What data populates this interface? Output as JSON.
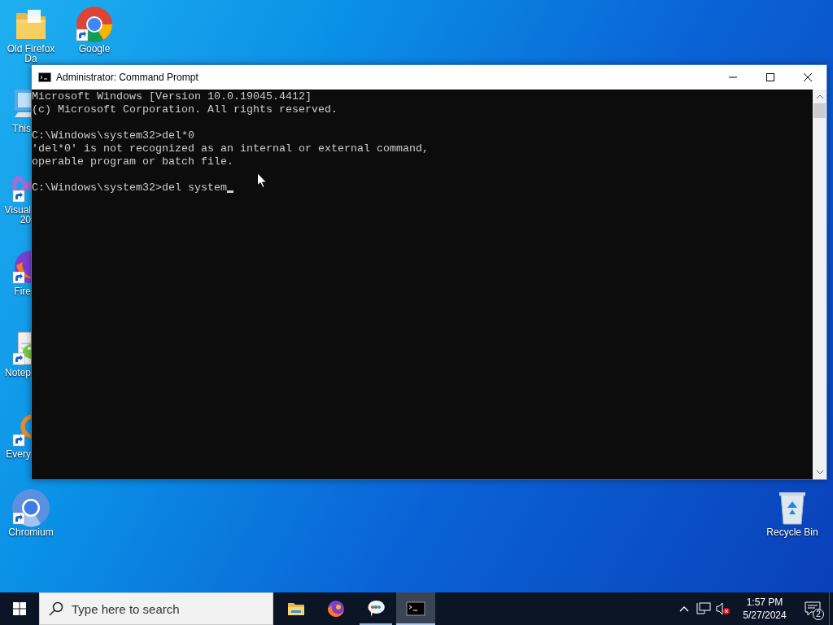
{
  "desktop_icons": [
    {
      "kind": "folder",
      "lines": [
        "Old Firefox",
        "Da"
      ],
      "shortcut": false
    },
    {
      "kind": "chrome",
      "lines": [
        "Google"
      ],
      "shortcut": true
    },
    {
      "kind": "computer",
      "lines": [
        "This"
      ],
      "shortcut": false
    },
    {
      "kind": "studio",
      "lines": [
        "Visual",
        "20"
      ],
      "shortcut": true
    },
    {
      "kind": "firefox",
      "lines": [
        "Fire"
      ],
      "shortcut": true
    },
    {
      "kind": "notepad",
      "lines": [
        "Notep"
      ],
      "shortcut": true
    },
    {
      "kind": "search",
      "lines": [
        "Every"
      ],
      "shortcut": true
    },
    {
      "kind": "chromium",
      "lines": [
        "Chromium"
      ],
      "shortcut": true
    },
    {
      "kind": "recycle",
      "lines": [
        "Recycle Bin"
      ],
      "shortcut": false
    }
  ],
  "window": {
    "title": "Administrator: Command Prompt",
    "console": {
      "blocks": [
        [
          "Microsoft Windows [Version 10.0.19045.4412]",
          "(c) Microsoft Corporation. All rights reserved."
        ],
        [
          "C:\\Windows\\system32>del*0",
          "'del*0' is not recognized as an internal or external command,",
          "operable program or batch file."
        ],
        [
          "C:\\Windows\\system32>del system"
        ]
      ],
      "cursor": true
    }
  },
  "taskbar": {
    "search": {
      "placeholder": "Type here to search"
    },
    "apps": [
      {
        "kind": "explorer",
        "running": false,
        "selected": false
      },
      {
        "kind": "firefox",
        "running": false,
        "selected": false
      },
      {
        "kind": "talk",
        "running": true,
        "selected": false
      },
      {
        "kind": "console",
        "running": true,
        "selected": true
      }
    ],
    "tray": {
      "volume_muted": true,
      "time": "1:57 PM",
      "date": "5/27/2024",
      "notifications": "2"
    }
  }
}
